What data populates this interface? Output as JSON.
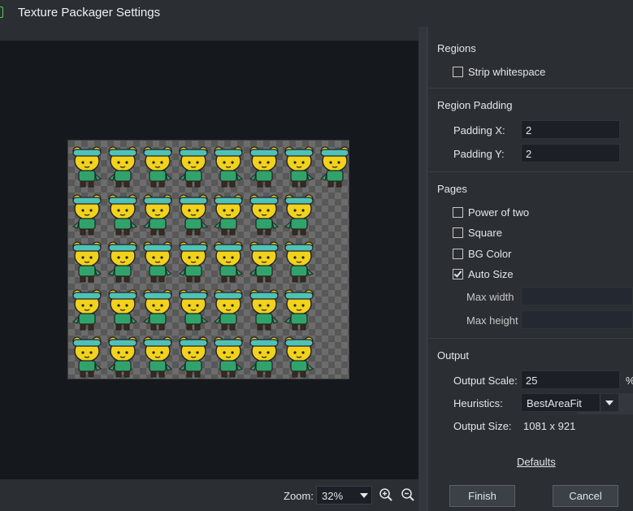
{
  "window": {
    "title": "Texture Packager Settings"
  },
  "preview": {
    "zoom_label": "Zoom:",
    "zoom_value": "32%"
  },
  "settings": {
    "regions": {
      "heading": "Regions",
      "strip_whitespace": {
        "label": "Strip whitespace",
        "checked": false
      }
    },
    "region_padding": {
      "heading": "Region Padding",
      "padding_x": {
        "label": "Padding X:",
        "value": "2"
      },
      "padding_y": {
        "label": "Padding Y:",
        "value": "2"
      }
    },
    "pages": {
      "heading": "Pages",
      "power_of_two": {
        "label": "Power of two",
        "checked": false
      },
      "square": {
        "label": "Square",
        "checked": false
      },
      "bg_color": {
        "label": "BG Color",
        "checked": false
      },
      "auto_size": {
        "label": "Auto Size",
        "checked": true
      },
      "max_width": {
        "label": "Max width",
        "value": ""
      },
      "max_height": {
        "label": "Max height",
        "value": ""
      }
    },
    "output": {
      "heading": "Output",
      "scale": {
        "label": "Output Scale:",
        "value": "25",
        "suffix": "%"
      },
      "heuristics": {
        "label": "Heuristics:",
        "value": "BestAreaFit"
      },
      "size": {
        "label": "Output Size:",
        "value": "1081 x 921"
      }
    },
    "defaults_link": "Defaults"
  },
  "buttons": {
    "finish": "Finish",
    "cancel": "Cancel"
  },
  "colors": {
    "panel_bg": "#2b2e33",
    "preview_bg": "#15191e",
    "field_bg": "#1c2026",
    "character_body": "#f2d21c",
    "character_shirt": "#2fa36b",
    "character_goggles": "#4fc2b8"
  }
}
